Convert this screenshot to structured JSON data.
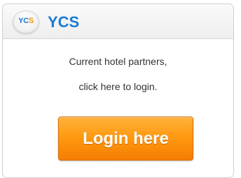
{
  "header": {
    "logo_part1": "YC",
    "logo_part2": "S",
    "title": "YCS"
  },
  "message": {
    "line1": "Current hotel partners,",
    "line2": "click here to login."
  },
  "login_button": {
    "label": "Login here"
  },
  "colors": {
    "brand_blue": "#1b7bd6",
    "logo_orange": "#f39200",
    "button_orange": "#ff9a12"
  }
}
